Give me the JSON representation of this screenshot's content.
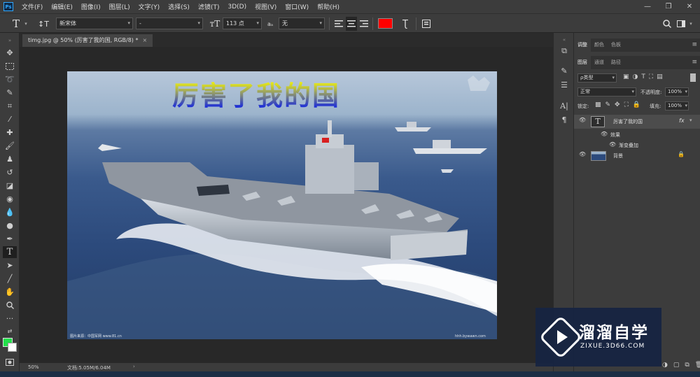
{
  "menubar": {
    "logo": "Ps",
    "items": [
      "文件(F)",
      "编辑(E)",
      "图像(I)",
      "图层(L)",
      "文字(Y)",
      "选择(S)",
      "滤镜(T)",
      "3D(D)",
      "视图(V)",
      "窗口(W)",
      "帮助(H)"
    ],
    "window_controls": [
      "—",
      "❐",
      "✕"
    ]
  },
  "options": {
    "font_family": "新宋体",
    "font_style": "-",
    "font_size": "113 点",
    "antialias_prefix": "aₐ",
    "antialias": "无",
    "text_color": "#ff0000"
  },
  "document": {
    "tab_title": "timg.jpg @ 50% (厉害了我的国, RGB/8) *",
    "headline_text": "厉害了我的国",
    "corner_caption_left": "图片来源：中国军网 www.81.cn",
    "corner_caption_right": "hhh.bywawn.com"
  },
  "status": {
    "zoom": "50%",
    "doc_info": "文档:5.05M/6.04M"
  },
  "panels": {
    "top_tabs": [
      "调整",
      "颜色",
      "色板"
    ],
    "layer_tabs": [
      "图层",
      "通道",
      "路径"
    ],
    "kind_label": "ρ类型",
    "blend_mode": "正常",
    "opacity_label": "不透明度:",
    "opacity_value": "100%",
    "lock_label": "锁定:",
    "fill_label": "填充:",
    "fill_value": "100%",
    "layers": [
      {
        "name": "厉害了我的国",
        "type_badge": "T",
        "fx": "fx"
      },
      {
        "name": "效果"
      },
      {
        "name": "渐变叠加"
      },
      {
        "name": "背景"
      }
    ]
  },
  "watermark": {
    "title": "溜溜自学",
    "url": "ZIXUE.3D66.COM"
  }
}
